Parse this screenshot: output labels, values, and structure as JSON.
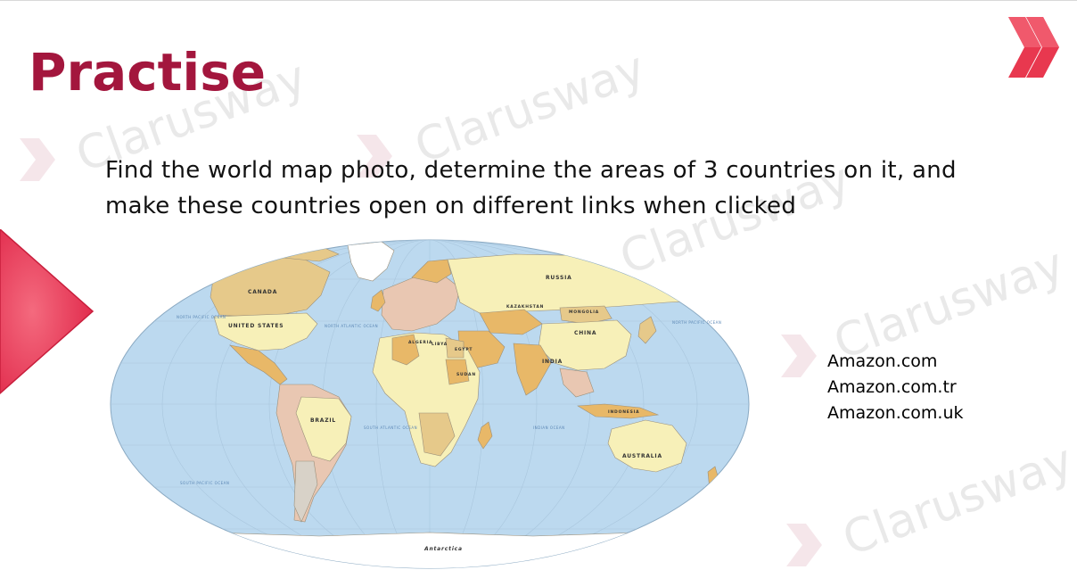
{
  "slide": {
    "title": "Practise",
    "instruction": "Find the world map photo, determine the areas of 3 countries on it, and make these countries open on different links when clicked",
    "links": [
      "Amazon.com",
      "Amazon.com.tr",
      "Amazon.com.uk"
    ],
    "watermark_text": "Clarusway"
  },
  "map": {
    "country_labels": {
      "canada": "CANADA",
      "united_states": "UNITED STATES",
      "brazil": "BRAZIL",
      "russia": "RUSSIA",
      "china": "CHINA",
      "india": "INDIA",
      "australia": "AUSTRALIA",
      "algeria": "ALGERIA",
      "libya": "LIBYA",
      "egypt": "EGYPT",
      "sudan": "SUDAN",
      "kazakhstan": "KAZAKHSTAN",
      "mongolia": "MONGOLIA",
      "indonesia": "INDONESIA",
      "antarctica": "Antarctica"
    },
    "ocean_labels": {
      "north_pacific_west": "NORTH PACIFIC OCEAN",
      "north_atlantic": "NORTH ATLANTIC OCEAN",
      "south_atlantic": "SOUTH ATLANTIC OCEAN",
      "indian": "INDIAN OCEAN",
      "north_pacific_east": "NORTH PACIFIC OCEAN",
      "south_pacific": "SOUTH PACIFIC OCEAN"
    }
  },
  "colors": {
    "brand": "#a3163d",
    "logo": "#e8384f",
    "ocean": "#bcd9ef",
    "land_cream": "#f7f0b8",
    "land_tan": "#e6c98a",
    "land_orange": "#e8b868",
    "land_pink": "#e9c7b2",
    "land_grey": "#d8d2c8",
    "ice": "#ffffff"
  }
}
